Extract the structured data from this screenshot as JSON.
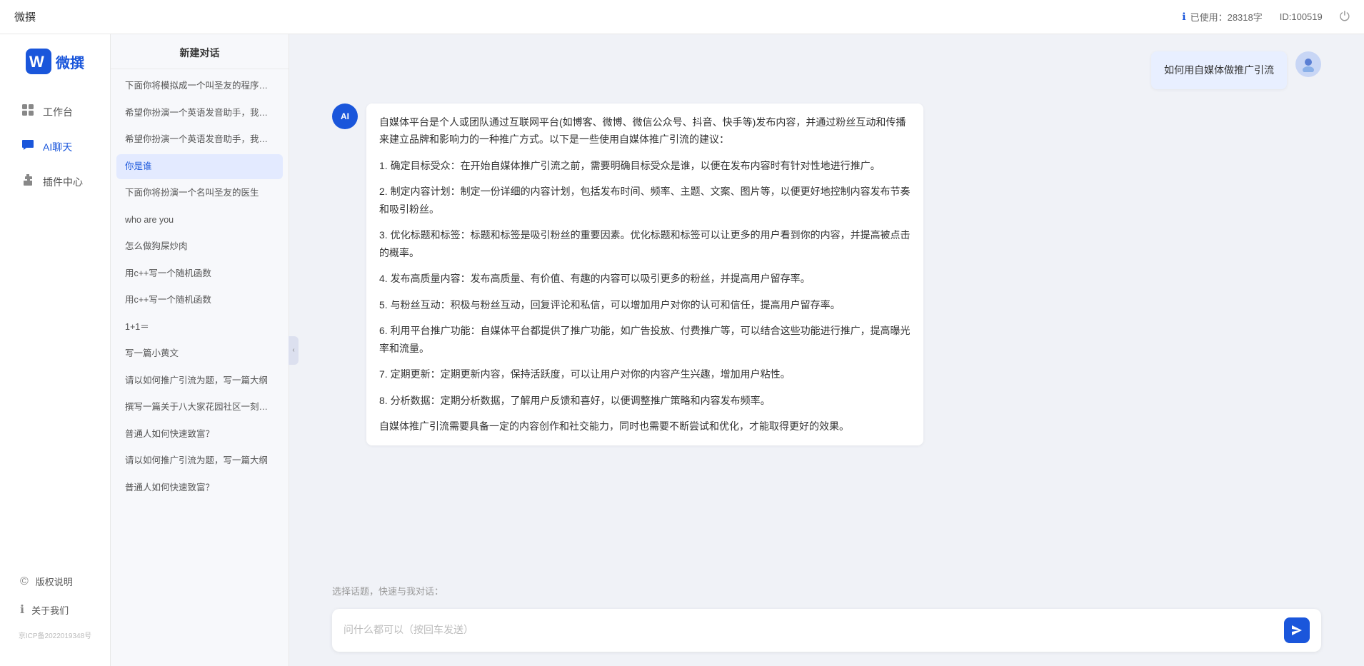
{
  "topbar": {
    "title": "微撰",
    "usage_label": "已使用：28318字",
    "id_label": "ID:100519",
    "usage_icon": "ℹ"
  },
  "brand": {
    "name": "微撰",
    "logo_letter": "W"
  },
  "nav": {
    "items": [
      {
        "id": "workbench",
        "label": "工作台",
        "icon": "⊞"
      },
      {
        "id": "ai-chat",
        "label": "AI聊天",
        "icon": "💬",
        "active": true
      },
      {
        "id": "plugin",
        "label": "插件中心",
        "icon": "🧩"
      }
    ],
    "bottom_items": [
      {
        "id": "copyright",
        "label": "版权说明",
        "icon": "©"
      },
      {
        "id": "about",
        "label": "关于我们",
        "icon": "ℹ"
      }
    ],
    "footer": "京ICP备2022019348号"
  },
  "conv_panel": {
    "header": "新建对话",
    "items": [
      {
        "id": 1,
        "text": "下面你将模拟成一个叫圣友的程序员，我说..."
      },
      {
        "id": 2,
        "text": "希望你扮演一个英语发音助手，我提供给你..."
      },
      {
        "id": 3,
        "text": "希望你扮演一个英语发音助手，我提供给你..."
      },
      {
        "id": 4,
        "text": "你是谁",
        "active": true
      },
      {
        "id": 5,
        "text": "下面你将扮演一个名叫圣友的医生"
      },
      {
        "id": 6,
        "text": "who are you"
      },
      {
        "id": 7,
        "text": "怎么做狗屎炒肉"
      },
      {
        "id": 8,
        "text": "用c++写一个随机函数"
      },
      {
        "id": 9,
        "text": "用c++写一个随机函数"
      },
      {
        "id": 10,
        "text": "1+1＝"
      },
      {
        "id": 11,
        "text": "写一篇小黄文"
      },
      {
        "id": 12,
        "text": "请以如何推广引流为题，写一篇大纲"
      },
      {
        "id": 13,
        "text": "撰写一篇关于八大家花园社区一刻钟便民生..."
      },
      {
        "id": 14,
        "text": "普通人如何快速致富？"
      },
      {
        "id": 15,
        "text": "请以如何推广引流为题，写一篇大纲"
      },
      {
        "id": 16,
        "text": "普通人如何快速致富？"
      }
    ]
  },
  "chat": {
    "user_question": "如何用自媒体做推广引流",
    "ai_response": {
      "paragraphs": [
        "自媒体平台是个人或团队通过互联网平台(如博客、微博、微信公众号、抖音、快手等)发布内容，并通过粉丝互动和传播来建立品牌和影响力的一种推广方式。以下是一些使用自媒体推广引流的建议：",
        "1. 确定目标受众：在开始自媒体推广引流之前，需要明确目标受众是谁，以便在发布内容时有针对性地进行推广。",
        "2. 制定内容计划：制定一份详细的内容计划，包括发布时间、频率、主题、文案、图片等，以便更好地控制内容发布节奏和吸引粉丝。",
        "3. 优化标题和标签：标题和标签是吸引粉丝的重要因素。优化标题和标签可以让更多的用户看到你的内容，并提高被点击的概率。",
        "4. 发布高质量内容：发布高质量、有价值、有趣的内容可以吸引更多的粉丝，并提高用户留存率。",
        "5. 与粉丝互动：积极与粉丝互动，回复评论和私信，可以增加用户对你的认可和信任，提高用户留存率。",
        "6. 利用平台推广功能：自媒体平台都提供了推广功能，如广告投放、付费推广等，可以结合这些功能进行推广，提高曝光率和流量。",
        "7. 定期更新：定期更新内容，保持活跃度，可以让用户对你的内容产生兴趣，增加用户粘性。",
        "8. 分析数据：定期分析数据，了解用户反馈和喜好，以便调整推广策略和内容发布频率。",
        "自媒体推广引流需要具备一定的内容创作和社交能力，同时也需要不断尝试和优化，才能取得更好的效果。"
      ]
    },
    "quick_topics_label": "选择话题，快速与我对话：",
    "input_placeholder": "问什么都可以（按回车发送）"
  }
}
